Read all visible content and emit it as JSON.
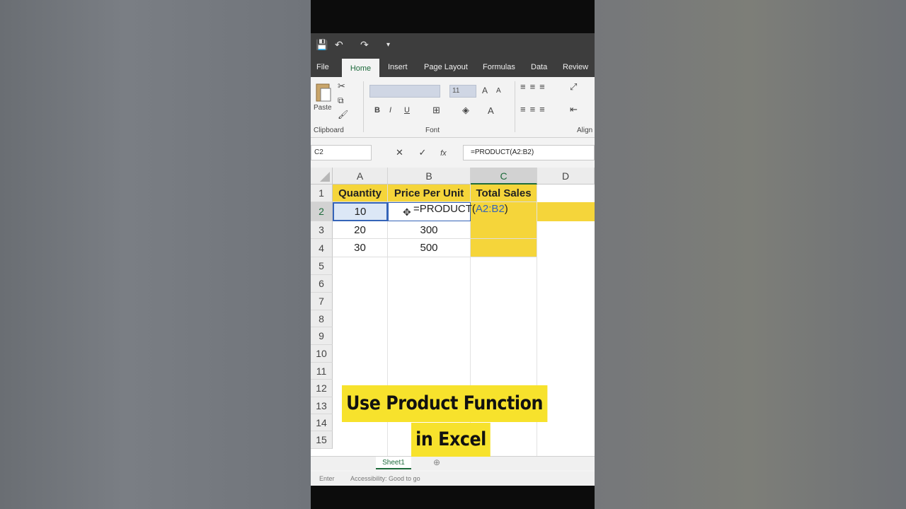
{
  "qat": {
    "save": "💾",
    "undo": "↶",
    "redo": "↷",
    "more": "▾"
  },
  "tabs": [
    {
      "label": "File"
    },
    {
      "label": "Home"
    },
    {
      "label": "Insert"
    },
    {
      "label": "Page Layout"
    },
    {
      "label": "Formulas"
    },
    {
      "label": "Data"
    },
    {
      "label": "Review"
    }
  ],
  "ribbon": {
    "paste_label": "Paste",
    "clipboard_label": "Clipboard",
    "font_label": "Font",
    "align_label": "Align",
    "font_size": "11",
    "bold": "B",
    "italic": "I",
    "underline": "U",
    "grow": "A",
    "shrink": "A",
    "font_color": "A"
  },
  "formula_bar": {
    "name_box": "C2",
    "cancel": "✕",
    "enter": "✓",
    "fx": "fx",
    "formula": "=PRODUCT(A2:B2)"
  },
  "grid": {
    "columns": [
      "A",
      "B",
      "C",
      "D"
    ],
    "rows": [
      "1",
      "2",
      "3",
      "4",
      "5",
      "6",
      "7",
      "8",
      "9",
      "10",
      "11",
      "12",
      "13",
      "14",
      "15"
    ],
    "headers": [
      "Quantity",
      "Price Per Unit",
      "Total Sales"
    ],
    "data": [
      [
        "10",
        "",
        ""
      ],
      [
        "20",
        "300",
        ""
      ],
      [
        "30",
        "500",
        ""
      ]
    ],
    "editing_prefix": "=PRODUCT(",
    "editing_ref": "A2:B2",
    "editing_suffix": ")"
  },
  "sheet_tab": "Sheet1",
  "status": {
    "mode": "Enter",
    "accessibility": "Accessibility: Good to go"
  },
  "caption": {
    "line1": "Use Product Function",
    "line2": "in Excel"
  },
  "colors": {
    "header_yellow": "#f5d53a",
    "caption_yellow": "#f7e22c",
    "excel_green": "#1e6b3c",
    "ref_blue": "#3564b8"
  }
}
